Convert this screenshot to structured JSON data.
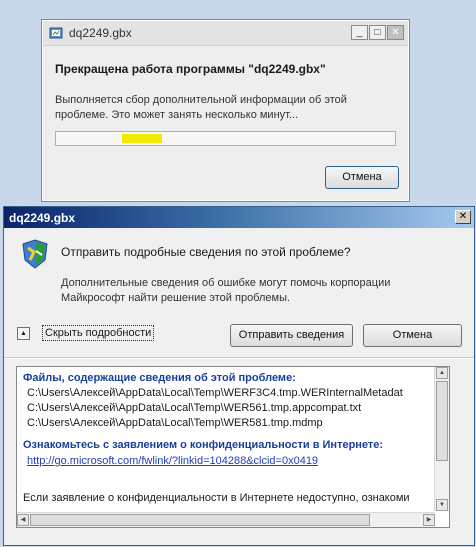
{
  "progress_dialog": {
    "title": "dq2249.gbx",
    "heading": "Прекращена работа программы \"dq2249.gbx\"",
    "message": "Выполняется сбор дополнительной информации об этой проблеме.  Это может занять несколько минут...",
    "cancel_label": "Отмена",
    "minimize_glyph": "_",
    "maximize_glyph": "□",
    "close_glyph": "✕",
    "progress_color": "#f2ea00"
  },
  "report_dialog": {
    "title": "dq2249.gbx",
    "close_glyph": "✕",
    "icon": "problem-report-shield-icon",
    "heading": "Отправить подробные сведения по этой проблеме?",
    "message": "Дополнительные сведения об ошибке могут помочь корпорации Майкрософт найти решение этой проблемы.",
    "toggle_glyph": "▲",
    "hide_details_label": "Скрыть подробности",
    "send_label": "Отправить сведения",
    "cancel_label": "Отмена",
    "details": {
      "files_heading": "Файлы, содержащие сведения об этой проблеме:",
      "files": [
        "C:\\Users\\Алексей\\AppData\\Local\\Temp\\WERF3C4.tmp.WERInternalMetadat",
        "C:\\Users\\Алексей\\AppData\\Local\\Temp\\WER561.tmp.appcompat.txt",
        "C:\\Users\\Алексей\\AppData\\Local\\Temp\\WER581.tmp.mdmp"
      ],
      "privacy_heading": "Ознакомьтесь с заявлением о конфиденциальности в Интернете:",
      "privacy_link": "http://go.microsoft.com/fwlink/?linkid=104288&clcid=0x0419",
      "trailing_text": "Если заявление о конфиденциальности в Интернете недоступно, ознакоми"
    }
  }
}
